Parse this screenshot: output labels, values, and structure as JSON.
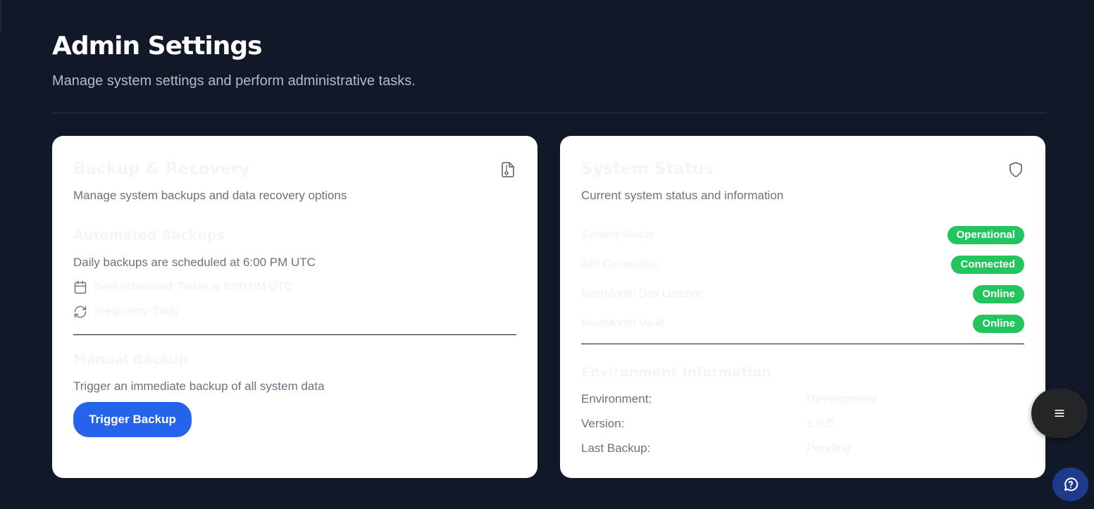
{
  "header": {
    "title": "Admin Settings",
    "subtitle": "Manage system settings and perform administrative tasks."
  },
  "backup_card": {
    "title": "Backup & Recovery",
    "description": "Manage system backups and data recovery options",
    "icon": "file-archive-icon",
    "automated": {
      "title": "Automated Backups",
      "schedule_text": "Daily backups are scheduled at 6:00 PM UTC",
      "next_scheduled": "Next scheduled: Today at 6:00 PM UTC",
      "frequency": "Frequency: Daily"
    },
    "manual": {
      "title": "Manual Backup",
      "description": "Trigger an immediate backup of all system data",
      "button_label": "Trigger Backup"
    }
  },
  "status_card": {
    "title": "System Status",
    "description": "Current system status and information",
    "icon": "shield-icon",
    "statuses": [
      {
        "label": "System Status",
        "value": "Operational"
      },
      {
        "label": "API Connection",
        "value": "Connected"
      },
      {
        "label": "NextMonth Dev Listener",
        "value": "Online"
      },
      {
        "label": "NextMonth Vault",
        "value": "Online"
      }
    ],
    "environment": {
      "title": "Environment Information",
      "rows": [
        {
          "label": "Environment:",
          "value": "Development"
        },
        {
          "label": "Version:",
          "value": "1.0.0"
        },
        {
          "label": "Last Backup:",
          "value": "Pending"
        }
      ]
    }
  },
  "colors": {
    "background": "#111827",
    "card": "#ffffff",
    "primary": "#2563eb",
    "success": "#22c55e"
  }
}
